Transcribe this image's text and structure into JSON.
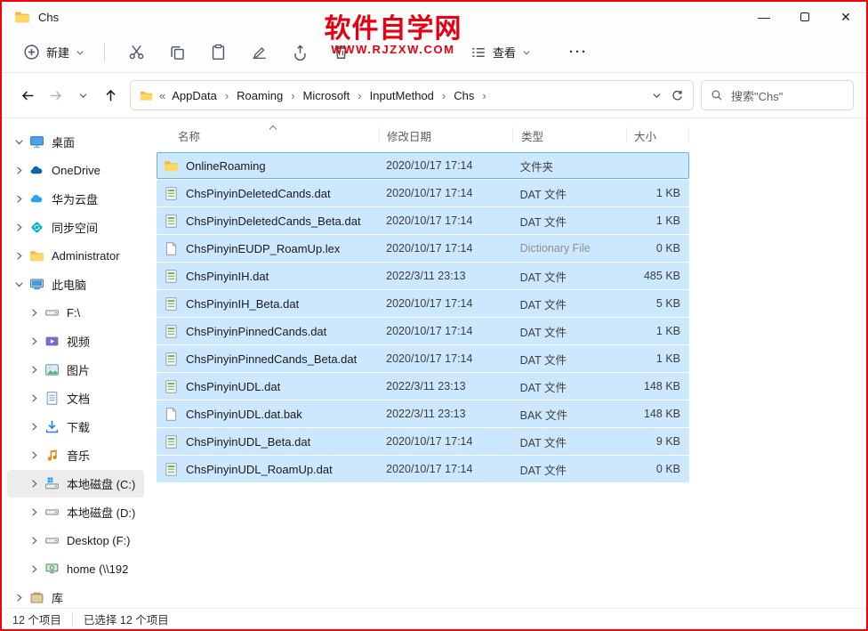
{
  "window": {
    "title": "Chs",
    "minimize_glyph": "—",
    "close_glyph": "✕"
  },
  "watermark": {
    "title": "软件自学网",
    "url": "WWW.RJZXW.COM"
  },
  "toolbar": {
    "new_label": "新建",
    "view_label": "查看",
    "more_glyph": "···",
    "buttons": [
      {
        "icon": "cut",
        "name": "cut-button"
      },
      {
        "icon": "copy",
        "name": "copy-button"
      },
      {
        "icon": "paste",
        "name": "paste-button"
      },
      {
        "icon": "rename",
        "name": "rename-button"
      },
      {
        "icon": "share",
        "name": "share-button"
      },
      {
        "icon": "delete",
        "name": "delete-button"
      }
    ]
  },
  "addressbar": {
    "prefix": "«",
    "crumbs": [
      {
        "label": "AppData"
      },
      {
        "label": "Roaming"
      },
      {
        "label": "Microsoft"
      },
      {
        "label": "InputMethod"
      },
      {
        "label": "Chs"
      }
    ],
    "search_text": "搜索\"Chs\""
  },
  "sidebar": {
    "items": [
      {
        "label": "桌面",
        "icon": "desktop",
        "level": 0,
        "expanded": true,
        "name": "sidebar-item-desktop"
      },
      {
        "label": "OneDrive",
        "icon": "onedrive",
        "level": 0,
        "name": "sidebar-item-onedrive"
      },
      {
        "label": "华为云盘",
        "icon": "cloud",
        "level": 0,
        "name": "sidebar-item-huawei-cloud"
      },
      {
        "label": "同步空间",
        "icon": "sync",
        "level": 0,
        "name": "sidebar-item-sync-space"
      },
      {
        "label": "Administrator",
        "icon": "folder",
        "level": 0,
        "name": "sidebar-item-administrator"
      },
      {
        "label": "此电脑",
        "icon": "computer",
        "level": 0,
        "expanded": true,
        "name": "sidebar-item-this-pc"
      },
      {
        "label": "F:\\",
        "icon": "drive",
        "level": 1,
        "name": "sidebar-item-drive-f"
      },
      {
        "label": "视频",
        "icon": "video",
        "level": 1,
        "name": "sidebar-item-videos"
      },
      {
        "label": "图片",
        "icon": "picture",
        "level": 1,
        "name": "sidebar-item-pictures"
      },
      {
        "label": "文档",
        "icon": "doc",
        "level": 1,
        "name": "sidebar-item-documents"
      },
      {
        "label": "下载",
        "icon": "download",
        "level": 1,
        "name": "sidebar-item-downloads"
      },
      {
        "label": "音乐",
        "icon": "music",
        "level": 1,
        "name": "sidebar-item-music"
      },
      {
        "label": "本地磁盘 (C:)",
        "icon": "drive-win",
        "level": 1,
        "selected": true,
        "name": "sidebar-item-local-disk-c"
      },
      {
        "label": "本地磁盘 (D:)",
        "icon": "drive",
        "level": 1,
        "name": "sidebar-item-local-disk-d"
      },
      {
        "label": "Desktop (F:)",
        "icon": "drive",
        "level": 1,
        "name": "sidebar-item-desktop-f"
      },
      {
        "label": "home (\\\\192",
        "icon": "network",
        "level": 1,
        "name": "sidebar-item-home-share"
      },
      {
        "label": "库",
        "icon": "library",
        "level": 0,
        "name": "sidebar-item-libraries"
      }
    ]
  },
  "filelist": {
    "columns": [
      {
        "label": "名称"
      },
      {
        "label": "修改日期"
      },
      {
        "label": "类型"
      },
      {
        "label": "大小"
      }
    ],
    "rows": [
      {
        "name": "OnlineRoaming",
        "date": "2020/10/17 17:14",
        "type": "文件夹",
        "size": "",
        "icon": "folder",
        "focused": true
      },
      {
        "name": "ChsPinyinDeletedCands.dat",
        "date": "2020/10/17 17:14",
        "type": "DAT 文件",
        "size": "1 KB",
        "icon": "dat"
      },
      {
        "name": "ChsPinyinDeletedCands_Beta.dat",
        "date": "2020/10/17 17:14",
        "type": "DAT 文件",
        "size": "1 KB",
        "icon": "dat"
      },
      {
        "name": "ChsPinyinEUDP_RoamUp.lex",
        "date": "2020/10/17 17:14",
        "type": "Dictionary File",
        "size": "0 KB",
        "icon": "file",
        "muted": true
      },
      {
        "name": "ChsPinyinIH.dat",
        "date": "2022/3/11 23:13",
        "type": "DAT 文件",
        "size": "485 KB",
        "icon": "dat"
      },
      {
        "name": "ChsPinyinIH_Beta.dat",
        "date": "2020/10/17 17:14",
        "type": "DAT 文件",
        "size": "5 KB",
        "icon": "dat"
      },
      {
        "name": "ChsPinyinPinnedCands.dat",
        "date": "2020/10/17 17:14",
        "type": "DAT 文件",
        "size": "1 KB",
        "icon": "dat"
      },
      {
        "name": "ChsPinyinPinnedCands_Beta.dat",
        "date": "2020/10/17 17:14",
        "type": "DAT 文件",
        "size": "1 KB",
        "icon": "dat"
      },
      {
        "name": "ChsPinyinUDL.dat",
        "date": "2022/3/11 23:13",
        "type": "DAT 文件",
        "size": "148 KB",
        "icon": "dat"
      },
      {
        "name": "ChsPinyinUDL.dat.bak",
        "date": "2022/3/11 23:13",
        "type": "BAK 文件",
        "size": "148 KB",
        "icon": "file"
      },
      {
        "name": "ChsPinyinUDL_Beta.dat",
        "date": "2020/10/17 17:14",
        "type": "DAT 文件",
        "size": "9 KB",
        "icon": "dat"
      },
      {
        "name": "ChsPinyinUDL_RoamUp.dat",
        "date": "2020/10/17 17:14",
        "type": "DAT 文件",
        "size": "0 KB",
        "icon": "dat"
      }
    ]
  },
  "statusbar": {
    "total": "12 个项目",
    "selected": "已选择 12 个项目"
  }
}
